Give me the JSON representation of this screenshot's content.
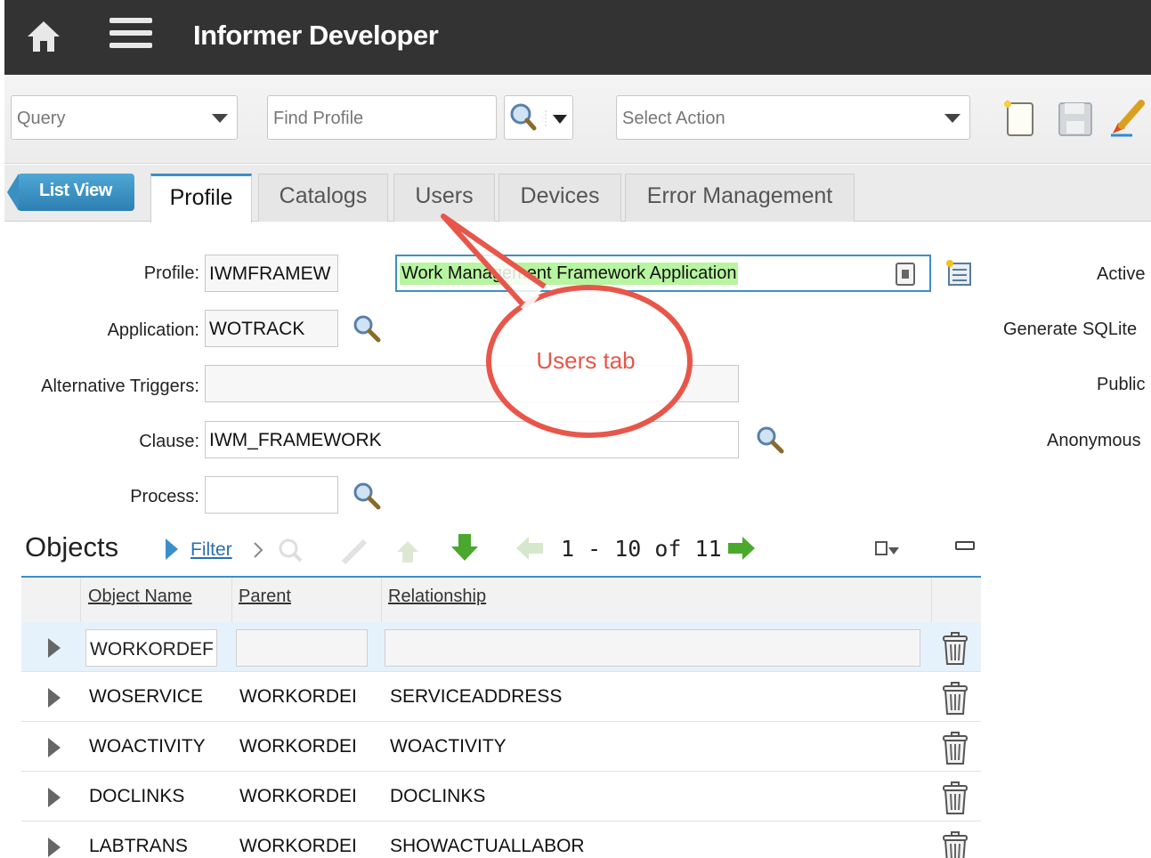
{
  "header": {
    "title": "Informer Developer",
    "home_icon": "home-icon",
    "menu_icon": "hamburger-menu-icon"
  },
  "toolbar": {
    "query_select": "Query",
    "find_placeholder": "Find Profile",
    "action_select": "Select Action",
    "icons": [
      "new-record-icon",
      "save-icon",
      "clear-icon"
    ]
  },
  "tabs": {
    "list_view": "List View",
    "items": [
      "Profile",
      "Catalogs",
      "Users",
      "Devices",
      "Error Management"
    ],
    "active": "Profile"
  },
  "form": {
    "profile_label": "Profile:",
    "profile_value": "IWMFRAMEW",
    "description_value": "Work Management Framework Application",
    "application_label": "Application:",
    "application_value": "WOTRACK",
    "alt_triggers_label": "Alternative Triggers:",
    "alt_triggers_value": "",
    "clause_label": "Clause:",
    "clause_value": "IWM_FRAMEWORK",
    "process_label": "Process:",
    "process_value": "",
    "right_labels": [
      "Active",
      "Generate SQLite",
      "Public",
      "Anonymous"
    ]
  },
  "callout": {
    "text": "Users tab",
    "color": "#e8564a"
  },
  "objects": {
    "title": "Objects",
    "filter_label": "Filter",
    "pager_text": "1 - 10 of 11",
    "columns": [
      "Object Name",
      "Parent",
      "Relationship"
    ],
    "rows": [
      {
        "name": "WORKORDEF",
        "parent": "",
        "relationship": ""
      },
      {
        "name": "WOSERVICE",
        "parent": "WORKORDEI",
        "relationship": "SERVICEADDRESS"
      },
      {
        "name": "WOACTIVITY",
        "parent": "WORKORDEI",
        "relationship": "WOACTIVITY"
      },
      {
        "name": "DOCLINKS",
        "parent": "WORKORDEI",
        "relationship": "DOCLINKS"
      },
      {
        "name": "LABTRANS",
        "parent": "WORKORDEI",
        "relationship": "SHOWACTUALLABOR"
      }
    ]
  },
  "colors": {
    "header_bg": "#333333",
    "accent": "#3b8fc8",
    "highlight": "#b8f5a0",
    "green_arrow": "#4aa82c"
  }
}
